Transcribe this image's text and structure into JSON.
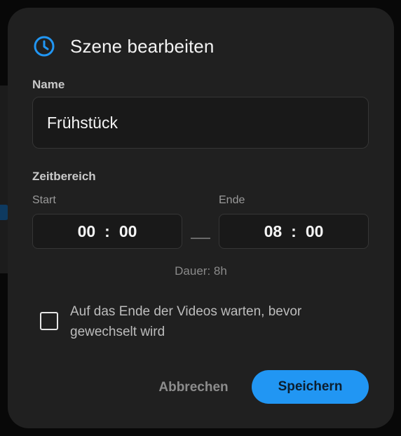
{
  "dialog": {
    "title": "Szene bearbeiten",
    "icon": "clock-icon",
    "accent_color": "#2196f3"
  },
  "name_section": {
    "label": "Name",
    "value": "Frühstück"
  },
  "time_section": {
    "label": "Zeitbereich",
    "start": {
      "label": "Start",
      "hours": "00",
      "separator": ":",
      "minutes": "00"
    },
    "end": {
      "label": "Ende",
      "hours": "08",
      "separator": ":",
      "minutes": "00"
    },
    "duration_text": "Dauer: 8h"
  },
  "wait_option": {
    "checked": false,
    "label": "Auf das Ende der Videos warten, bevor gewechselt wird"
  },
  "actions": {
    "cancel_label": "Abbrechen",
    "save_label": "Speichern"
  }
}
